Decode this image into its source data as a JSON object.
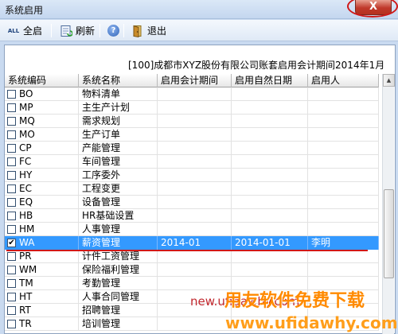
{
  "window": {
    "title": "系统启用",
    "close_label": "X"
  },
  "toolbar": {
    "select_all_icon": "ALL",
    "select_all_label": "全启",
    "refresh_label": "刷新",
    "help_icon": "?",
    "exit_label": "退出"
  },
  "info": "[100]成都市XYZ股份有限公司账套启用会计期间2014年1月",
  "columns": [
    "系统编码",
    "系统名称",
    "启用会计期间",
    "启用自然日期",
    "启用人"
  ],
  "rows": [
    {
      "code": "BO",
      "name": "物料清单",
      "period": "",
      "date": "",
      "user": "",
      "checked": false
    },
    {
      "code": "MP",
      "name": "主生产计划",
      "period": "",
      "date": "",
      "user": "",
      "checked": false
    },
    {
      "code": "MQ",
      "name": "需求规划",
      "period": "",
      "date": "",
      "user": "",
      "checked": false
    },
    {
      "code": "MO",
      "name": "生产订单",
      "period": "",
      "date": "",
      "user": "",
      "checked": false
    },
    {
      "code": "CP",
      "name": "产能管理",
      "period": "",
      "date": "",
      "user": "",
      "checked": false
    },
    {
      "code": "FC",
      "name": "车间管理",
      "period": "",
      "date": "",
      "user": "",
      "checked": false
    },
    {
      "code": "HY",
      "name": "工序委外",
      "period": "",
      "date": "",
      "user": "",
      "checked": false
    },
    {
      "code": "EC",
      "name": "工程变更",
      "period": "",
      "date": "",
      "user": "",
      "checked": false
    },
    {
      "code": "EQ",
      "name": "设备管理",
      "period": "",
      "date": "",
      "user": "",
      "checked": false
    },
    {
      "code": "HB",
      "name": "HR基础设置",
      "period": "",
      "date": "",
      "user": "",
      "checked": false
    },
    {
      "code": "HM",
      "name": "人事管理",
      "period": "",
      "date": "",
      "user": "",
      "checked": false
    },
    {
      "code": "WA",
      "name": "薪资管理",
      "period": "2014-01",
      "date": "2014-01-01",
      "user": "李明",
      "checked": true
    },
    {
      "code": "PR",
      "name": "计件工资管理",
      "period": "",
      "date": "",
      "user": "",
      "checked": false
    },
    {
      "code": "WM",
      "name": "保险福利管理",
      "period": "",
      "date": "",
      "user": "",
      "checked": false
    },
    {
      "code": "TM",
      "name": "考勤管理",
      "period": "",
      "date": "",
      "user": "",
      "checked": false
    },
    {
      "code": "HT",
      "name": "人事合同管理",
      "period": "",
      "date": "",
      "user": "",
      "checked": false
    },
    {
      "code": "RT",
      "name": "招聘管理",
      "period": "",
      "date": "",
      "user": "",
      "checked": false
    },
    {
      "code": "TR",
      "name": "培训管理",
      "period": "",
      "date": "",
      "user": "",
      "checked": false
    }
  ],
  "selected_row_code": "WA",
  "watermark": {
    "line1": "new.ufidawhy.com",
    "line2": "用友软件免费下载",
    "line3": "www.ufidawhy.com"
  },
  "colors": {
    "selection": "#3399ff",
    "annotation_red": "#d01818",
    "watermark_orange": "#ff8a00"
  }
}
